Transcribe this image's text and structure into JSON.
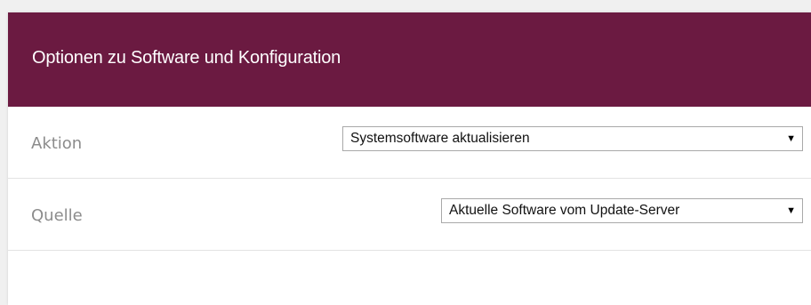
{
  "panel": {
    "title": "Optionen zu Software und Konfiguration"
  },
  "fields": [
    {
      "label": "Aktion",
      "selected": "Systemsoftware aktualisieren"
    },
    {
      "label": "Quelle",
      "selected": "Aktuelle Software vom Update-Server"
    }
  ],
  "icons": {
    "dropdown_arrow": "▼"
  },
  "colors": {
    "header_bg": "#6b1a41",
    "header_text": "#ffffff",
    "label_text": "#8c8c8c"
  }
}
